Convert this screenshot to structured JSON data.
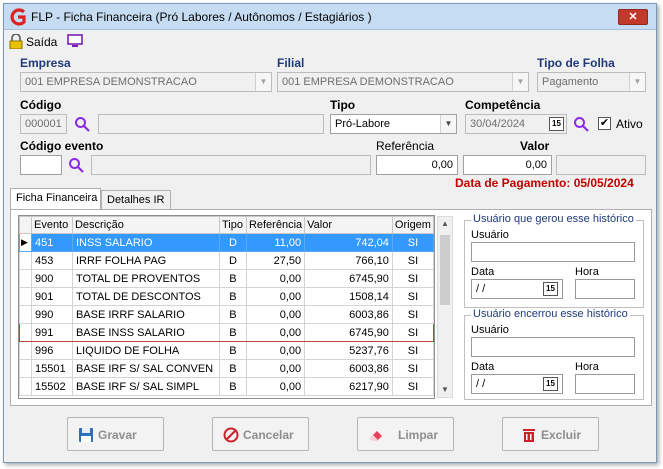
{
  "window": {
    "title": "FLP - Ficha Financeira (Pró Labores / Autônomos / Estagiários )"
  },
  "toolbar": {
    "exit_label": "Saída"
  },
  "form": {
    "empresa": {
      "label": "Empresa",
      "value": "001 EMPRESA DEMONSTRACAO"
    },
    "filial": {
      "label": "Filial",
      "value": "001 EMPRESA DEMONSTRACAO"
    },
    "tipo_folha": {
      "label": "Tipo de Folha",
      "value": "Pagamento"
    },
    "codigo": {
      "label": "Código",
      "value": "000001",
      "name_value": ""
    },
    "tipo": {
      "label": "Tipo",
      "value": "Pró-Labore"
    },
    "competencia": {
      "label": "Competência",
      "value": "30/04/2024",
      "cal_icon": "15"
    },
    "ativo": {
      "label": "Ativo",
      "checked": true,
      "check_mark": "✔"
    },
    "codigo_evento": {
      "label": "Código evento",
      "value": "",
      "desc_value": ""
    },
    "referencia": {
      "label": "Referência",
      "value": "0,00"
    },
    "valor": {
      "label": "Valor",
      "value": "0,00",
      "extra_value": ""
    },
    "data_pagamento": {
      "text": "Data de Pagamento: 05/05/2024",
      "color": "#c00000"
    }
  },
  "tabs": [
    {
      "label": "Ficha Financeira"
    },
    {
      "label": "Detalhes IR"
    }
  ],
  "grid": {
    "columns": [
      "Evento",
      "Descrição",
      "Tipo",
      "Referência",
      "Valor",
      "Origem"
    ],
    "row_indicator": "▶",
    "rows": [
      {
        "evento": "451",
        "descricao": "INSS SALARIO",
        "tipo": "D",
        "referencia": "11,00",
        "valor": "742,04",
        "origem": "SI"
      },
      {
        "evento": "453",
        "descricao": "IRRF FOLHA PAG",
        "tipo": "D",
        "referencia": "27,50",
        "valor": "766,10",
        "origem": "SI"
      },
      {
        "evento": "900",
        "descricao": "TOTAL DE PROVENTOS",
        "tipo": "B",
        "referencia": "0,00",
        "valor": "6745,90",
        "origem": "SI"
      },
      {
        "evento": "901",
        "descricao": "TOTAL DE DESCONTOS",
        "tipo": "B",
        "referencia": "0,00",
        "valor": "1508,14",
        "origem": "SI"
      },
      {
        "evento": "990",
        "descricao": "BASE IRRF SALARIO",
        "tipo": "B",
        "referencia": "0,00",
        "valor": "6003,86",
        "origem": "SI"
      },
      {
        "evento": "991",
        "descricao": "BASE INSS SALARIO",
        "tipo": "B",
        "referencia": "0,00",
        "valor": "6745,90",
        "origem": "SI"
      },
      {
        "evento": "996",
        "descricao": "LIQUIDO DE FOLHA",
        "tipo": "B",
        "referencia": "0,00",
        "valor": "5237,76",
        "origem": "SI"
      },
      {
        "evento": "15501",
        "descricao": "BASE IRF S/ SAL CONVEN",
        "tipo": "B",
        "referencia": "0,00",
        "valor": "6003,86",
        "origem": "SI"
      },
      {
        "evento": "15502",
        "descricao": "BASE IRF S/ SAL SIMPL",
        "tipo": "B",
        "referencia": "0,00",
        "valor": "6217,90",
        "origem": "SI"
      }
    ]
  },
  "history_created": {
    "legend": "Usuário que gerou esse histórico",
    "usuario_label": "Usuário",
    "usuario_value": "",
    "data_label": "Data",
    "data_value": "/ /",
    "hora_label": "Hora",
    "hora_value": "",
    "cal_icon": "15"
  },
  "history_closed": {
    "legend": "Usuário encerrou esse histórico",
    "usuario_label": "Usuário",
    "usuario_value": "",
    "data_label": "Data",
    "data_value": "/ /",
    "hora_label": "Hora",
    "hora_value": "",
    "cal_icon": "15"
  },
  "buttons": {
    "gravar": "Gravar",
    "cancelar": "Cancelar",
    "limpar": "Limpar",
    "excluir": "Excluir"
  },
  "icons": {
    "close": "✕",
    "dropdown": "▼",
    "scroll_up": "▲",
    "scroll_down": "▼"
  },
  "colors": {
    "selected_row": "#3399ff",
    "label_navy": "#1f3a7a",
    "titlebar": "#c6dcf2",
    "magnifier": "#8a2be2"
  }
}
